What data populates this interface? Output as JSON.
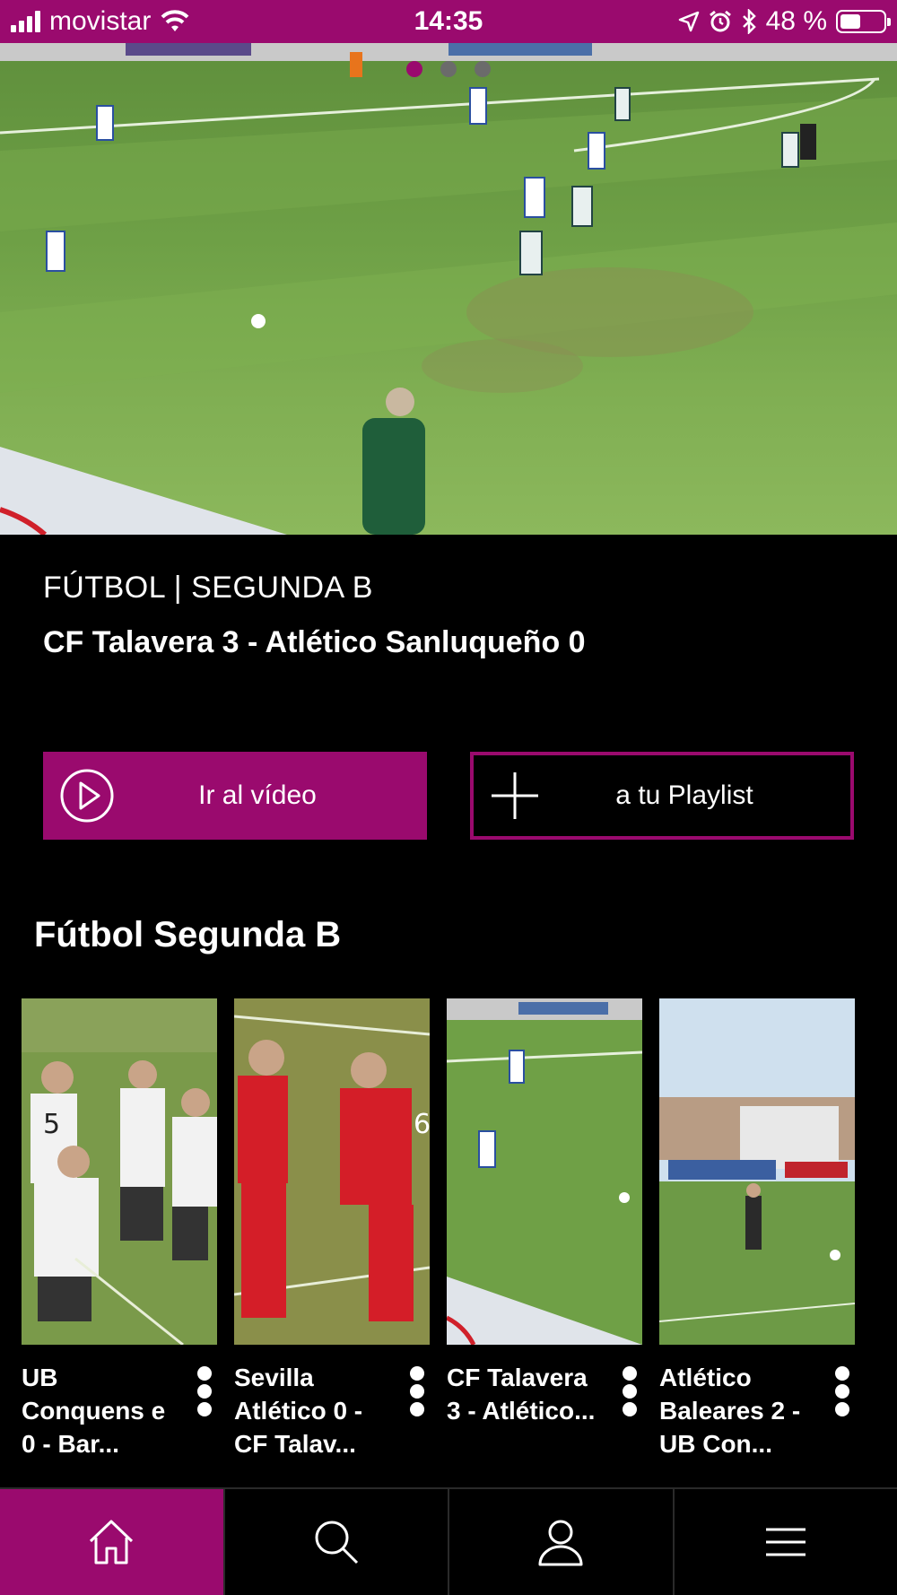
{
  "status_bar": {
    "carrier": "movistar",
    "time": "14:35",
    "battery": "48 %",
    "battery_level": 0.48,
    "icons": [
      "signal-icon",
      "wifi-icon",
      "location-icon",
      "alarm-icon",
      "bluetooth-icon",
      "battery-icon"
    ]
  },
  "hero": {
    "carousel_pages": 3,
    "active_page": 1
  },
  "featured": {
    "category": "FÚTBOL | SEGUNDA B",
    "title": "CF Talavera 3 - Atlético Sanluqueño 0"
  },
  "actions": {
    "play_label": "Ir al vídeo",
    "playlist_label": "a tu Playlist"
  },
  "section": {
    "title": "Fútbol Segunda B",
    "items": [
      {
        "title": "UB Conquens e 0 - Bar..."
      },
      {
        "title": "Sevilla Atlético 0 - CF Talav..."
      },
      {
        "title": "CF Talavera 3 - Atlético..."
      },
      {
        "title": "Atlético Baleares 2 - UB Con..."
      }
    ]
  },
  "bottom_nav": {
    "items": [
      "home-icon",
      "search-icon",
      "profile-icon",
      "menu-icon"
    ],
    "active": "home-icon"
  },
  "colors": {
    "brand": "#9a0a6e",
    "background": "#000000",
    "text": "#ffffff"
  }
}
